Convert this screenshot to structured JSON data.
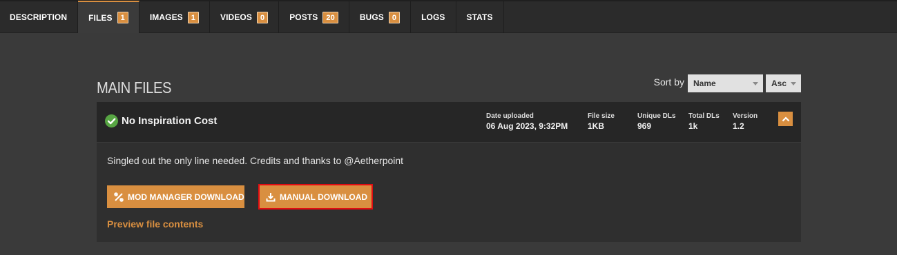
{
  "tabs": [
    {
      "label": "DESCRIPTION",
      "badge": null
    },
    {
      "label": "FILES",
      "badge": "1",
      "active": true
    },
    {
      "label": "IMAGES",
      "badge": "1"
    },
    {
      "label": "VIDEOS",
      "badge": "0"
    },
    {
      "label": "POSTS",
      "badge": "20"
    },
    {
      "label": "BUGS",
      "badge": "0"
    },
    {
      "label": "LOGS",
      "badge": null
    },
    {
      "label": "STATS",
      "badge": null
    }
  ],
  "section": {
    "title": "MAIN FILES",
    "sort_label": "Sort by",
    "sort_field": "Name",
    "sort_order": "Asc"
  },
  "file": {
    "name": "No Inspiration Cost",
    "meta": {
      "date_label": "Date uploaded",
      "date_value": "06 Aug 2023, 9:32PM",
      "size_label": "File size",
      "size_value": "1KB",
      "unique_label": "Unique DLs",
      "unique_value": "969",
      "total_label": "Total DLs",
      "total_value": "1k",
      "version_label": "Version",
      "version_value": "1.2"
    },
    "description": "Singled out the only line needed. Credits and thanks to @Aetherpoint",
    "mod_manager_label": "MOD MANAGER DOWNLOAD",
    "manual_label": "MANUAL DOWNLOAD",
    "preview_label": "Preview file contents"
  },
  "colors": {
    "accent": "#d98f40",
    "check": "#57a543",
    "highlight_border": "#e00d12"
  }
}
